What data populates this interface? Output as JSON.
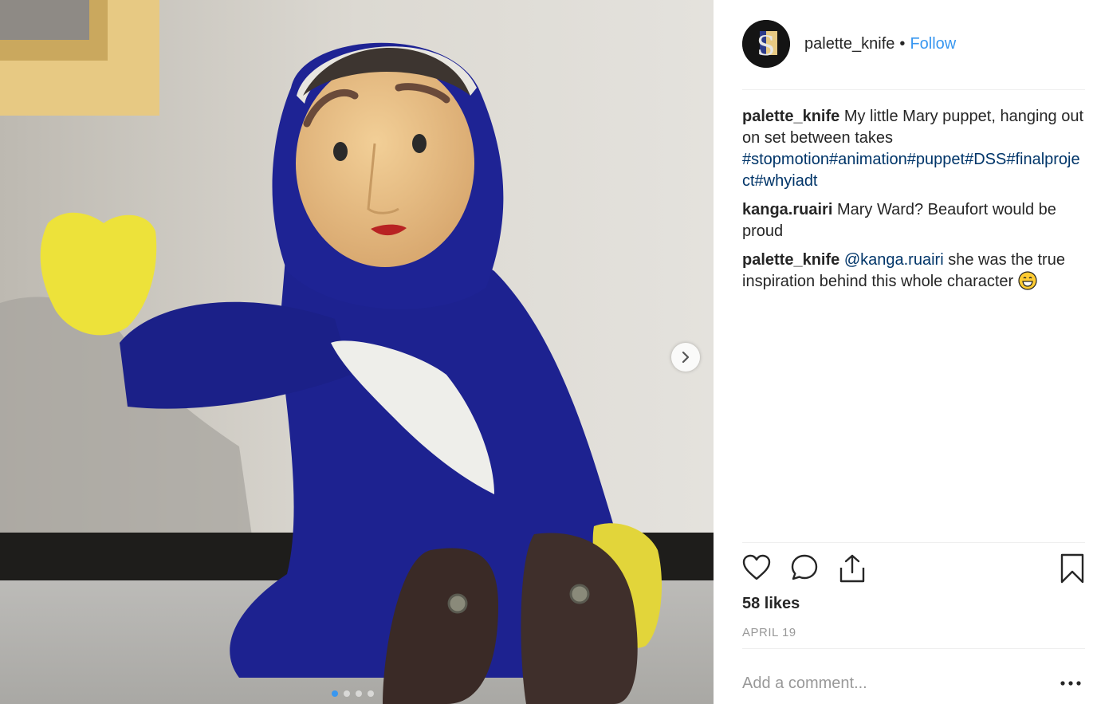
{
  "post": {
    "username": "palette_knife",
    "separator": "•",
    "follow_label": "Follow",
    "avatar_letter": "S"
  },
  "comments": [
    {
      "user": "palette_knife",
      "text": "My little Mary puppet, hanging out on set between takes",
      "hashtags": "#stopmotion#animation#puppet#DSS#finalproject#whyiadt"
    },
    {
      "user": "kanga.ruairi",
      "text": "Mary Ward? Beaufort would be proud"
    },
    {
      "user": "palette_knife",
      "mention": "@kanga.ruairi",
      "text": "she was the true inspiration behind this whole character",
      "emoji": "grinning-face"
    }
  ],
  "likes": "58 likes",
  "date": "APRIL 19",
  "add_comment_placeholder": "Add a comment...",
  "carousel": {
    "slide_count": 4,
    "active_index": 0
  },
  "icons": [
    "heart-icon",
    "comment-icon",
    "share-icon",
    "bookmark-icon",
    "chevron-right-icon",
    "more-icon"
  ],
  "colors": {
    "link": "#3897f0",
    "hashtag": "#003569",
    "muted": "#999999"
  }
}
